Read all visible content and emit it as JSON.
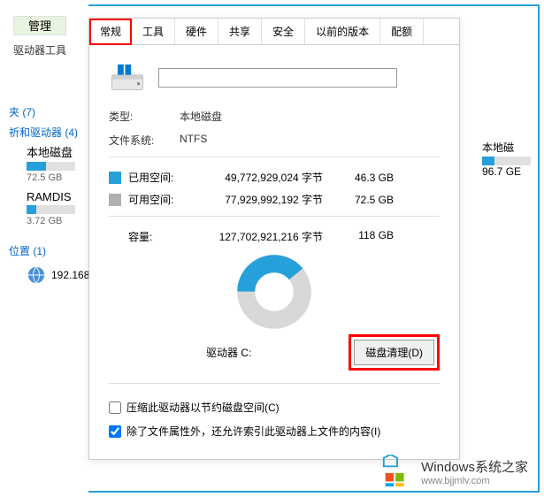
{
  "left": {
    "manage": "管理",
    "drive_tools": "驱动器工具",
    "folders": "夹 (7)",
    "drives": "祈和驱动器 (4)",
    "local_disk": {
      "name": "本地磁盘",
      "size": "72.5 GB"
    },
    "ramdisk": {
      "name": "RAMDIS",
      "size": "3.72 GB"
    },
    "location": "位置 (1)",
    "network": "192.168"
  },
  "tabs": {
    "general": "常规",
    "tools": "工具",
    "hardware": "硬件",
    "sharing": "共享",
    "security": "安全",
    "previous": "以前的版本",
    "quota": "配额"
  },
  "type_label": "类型:",
  "type_value": "本地磁盘",
  "fs_label": "文件系统:",
  "fs_value": "NTFS",
  "used_label": "已用空间:",
  "used_bytes": "49,772,929,024 字节",
  "used_gb": "46.3 GB",
  "free_label": "可用空间:",
  "free_bytes": "77,929,992,192 字节",
  "free_gb": "72.5 GB",
  "cap_label": "容量:",
  "cap_bytes": "127,702,921,216 字节",
  "cap_gb": "118 GB",
  "drive_c": "驱动器 C:",
  "cleanup_btn": "磁盘清理(D)",
  "compress_cb": "压缩此驱动器以节约磁盘空间(C)",
  "index_cb": "除了文件属性外，还允许索引此驱动器上文件的内容(I)",
  "chart_data": {
    "type": "pie",
    "title": "驱动器 C:",
    "series": [
      {
        "name": "已用空间",
        "value": 46.3,
        "color": "#26a0da"
      },
      {
        "name": "可用空间",
        "value": 72.5,
        "color": "#b0b0b0"
      }
    ],
    "unit": "GB",
    "total": 118
  },
  "right_drive": {
    "name": "本地磁",
    "size": "96.7 GE"
  },
  "watermark": {
    "title": "Windows系统之家",
    "url": "www.bjjmlv.com"
  }
}
